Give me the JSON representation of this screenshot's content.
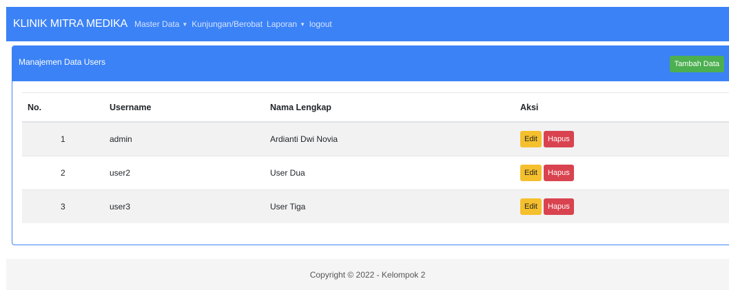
{
  "navbar": {
    "brand": "KLINIK MITRA MEDIKA",
    "items": [
      {
        "label": "Master Data",
        "dropdown": true
      },
      {
        "label": "Kunjungan/Berobat",
        "dropdown": false
      },
      {
        "label": "Laporan",
        "dropdown": true
      },
      {
        "label": "logout",
        "dropdown": false
      }
    ]
  },
  "card": {
    "title": "Manajemen Data Users",
    "add_button": "Tambah Data"
  },
  "table": {
    "headers": [
      "No.",
      "Username",
      "Nama Lengkap",
      "Aksi"
    ],
    "rows": [
      {
        "no": "1",
        "username": "admin",
        "nama": "Ardianti Dwi Novia"
      },
      {
        "no": "2",
        "username": "user2",
        "nama": "User Dua"
      },
      {
        "no": "3",
        "username": "user3",
        "nama": "User Tiga"
      }
    ],
    "edit_label": "Edit",
    "delete_label": "Hapus"
  },
  "footer": {
    "text": "Copyright © 2022 - Kelompok 2"
  },
  "colors": {
    "primary": "#3b82f6",
    "success": "#4caf50",
    "warning": "#f5c02d",
    "danger": "#d9434f"
  }
}
